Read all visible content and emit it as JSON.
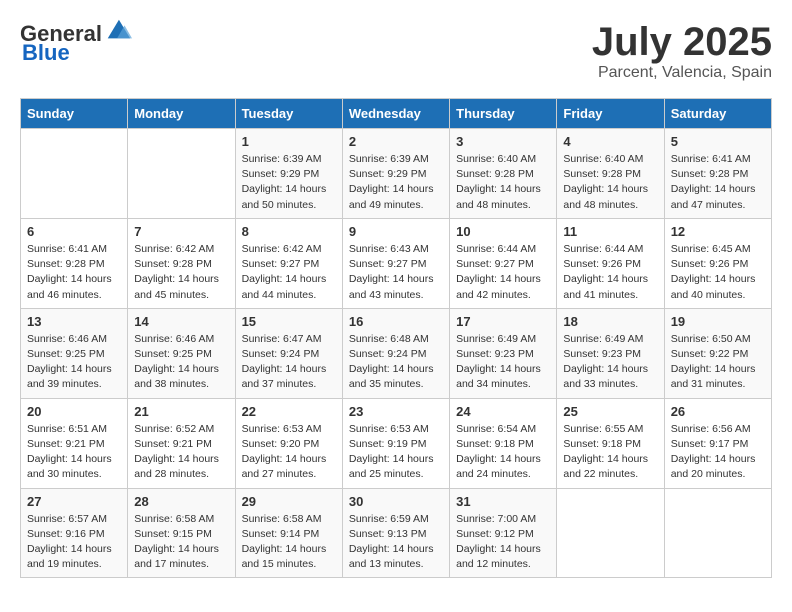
{
  "logo": {
    "general": "General",
    "blue": "Blue"
  },
  "title": {
    "month": "July 2025",
    "location": "Parcent, Valencia, Spain"
  },
  "days_of_week": [
    "Sunday",
    "Monday",
    "Tuesday",
    "Wednesday",
    "Thursday",
    "Friday",
    "Saturday"
  ],
  "weeks": [
    [
      {
        "day": "",
        "info": ""
      },
      {
        "day": "",
        "info": ""
      },
      {
        "day": "1",
        "info": "Sunrise: 6:39 AM\nSunset: 9:29 PM\nDaylight: 14 hours and 50 minutes."
      },
      {
        "day": "2",
        "info": "Sunrise: 6:39 AM\nSunset: 9:29 PM\nDaylight: 14 hours and 49 minutes."
      },
      {
        "day": "3",
        "info": "Sunrise: 6:40 AM\nSunset: 9:28 PM\nDaylight: 14 hours and 48 minutes."
      },
      {
        "day": "4",
        "info": "Sunrise: 6:40 AM\nSunset: 9:28 PM\nDaylight: 14 hours and 48 minutes."
      },
      {
        "day": "5",
        "info": "Sunrise: 6:41 AM\nSunset: 9:28 PM\nDaylight: 14 hours and 47 minutes."
      }
    ],
    [
      {
        "day": "6",
        "info": "Sunrise: 6:41 AM\nSunset: 9:28 PM\nDaylight: 14 hours and 46 minutes."
      },
      {
        "day": "7",
        "info": "Sunrise: 6:42 AM\nSunset: 9:28 PM\nDaylight: 14 hours and 45 minutes."
      },
      {
        "day": "8",
        "info": "Sunrise: 6:42 AM\nSunset: 9:27 PM\nDaylight: 14 hours and 44 minutes."
      },
      {
        "day": "9",
        "info": "Sunrise: 6:43 AM\nSunset: 9:27 PM\nDaylight: 14 hours and 43 minutes."
      },
      {
        "day": "10",
        "info": "Sunrise: 6:44 AM\nSunset: 9:27 PM\nDaylight: 14 hours and 42 minutes."
      },
      {
        "day": "11",
        "info": "Sunrise: 6:44 AM\nSunset: 9:26 PM\nDaylight: 14 hours and 41 minutes."
      },
      {
        "day": "12",
        "info": "Sunrise: 6:45 AM\nSunset: 9:26 PM\nDaylight: 14 hours and 40 minutes."
      }
    ],
    [
      {
        "day": "13",
        "info": "Sunrise: 6:46 AM\nSunset: 9:25 PM\nDaylight: 14 hours and 39 minutes."
      },
      {
        "day": "14",
        "info": "Sunrise: 6:46 AM\nSunset: 9:25 PM\nDaylight: 14 hours and 38 minutes."
      },
      {
        "day": "15",
        "info": "Sunrise: 6:47 AM\nSunset: 9:24 PM\nDaylight: 14 hours and 37 minutes."
      },
      {
        "day": "16",
        "info": "Sunrise: 6:48 AM\nSunset: 9:24 PM\nDaylight: 14 hours and 35 minutes."
      },
      {
        "day": "17",
        "info": "Sunrise: 6:49 AM\nSunset: 9:23 PM\nDaylight: 14 hours and 34 minutes."
      },
      {
        "day": "18",
        "info": "Sunrise: 6:49 AM\nSunset: 9:23 PM\nDaylight: 14 hours and 33 minutes."
      },
      {
        "day": "19",
        "info": "Sunrise: 6:50 AM\nSunset: 9:22 PM\nDaylight: 14 hours and 31 minutes."
      }
    ],
    [
      {
        "day": "20",
        "info": "Sunrise: 6:51 AM\nSunset: 9:21 PM\nDaylight: 14 hours and 30 minutes."
      },
      {
        "day": "21",
        "info": "Sunrise: 6:52 AM\nSunset: 9:21 PM\nDaylight: 14 hours and 28 minutes."
      },
      {
        "day": "22",
        "info": "Sunrise: 6:53 AM\nSunset: 9:20 PM\nDaylight: 14 hours and 27 minutes."
      },
      {
        "day": "23",
        "info": "Sunrise: 6:53 AM\nSunset: 9:19 PM\nDaylight: 14 hours and 25 minutes."
      },
      {
        "day": "24",
        "info": "Sunrise: 6:54 AM\nSunset: 9:18 PM\nDaylight: 14 hours and 24 minutes."
      },
      {
        "day": "25",
        "info": "Sunrise: 6:55 AM\nSunset: 9:18 PM\nDaylight: 14 hours and 22 minutes."
      },
      {
        "day": "26",
        "info": "Sunrise: 6:56 AM\nSunset: 9:17 PM\nDaylight: 14 hours and 20 minutes."
      }
    ],
    [
      {
        "day": "27",
        "info": "Sunrise: 6:57 AM\nSunset: 9:16 PM\nDaylight: 14 hours and 19 minutes."
      },
      {
        "day": "28",
        "info": "Sunrise: 6:58 AM\nSunset: 9:15 PM\nDaylight: 14 hours and 17 minutes."
      },
      {
        "day": "29",
        "info": "Sunrise: 6:58 AM\nSunset: 9:14 PM\nDaylight: 14 hours and 15 minutes."
      },
      {
        "day": "30",
        "info": "Sunrise: 6:59 AM\nSunset: 9:13 PM\nDaylight: 14 hours and 13 minutes."
      },
      {
        "day": "31",
        "info": "Sunrise: 7:00 AM\nSunset: 9:12 PM\nDaylight: 14 hours and 12 minutes."
      },
      {
        "day": "",
        "info": ""
      },
      {
        "day": "",
        "info": ""
      }
    ]
  ]
}
